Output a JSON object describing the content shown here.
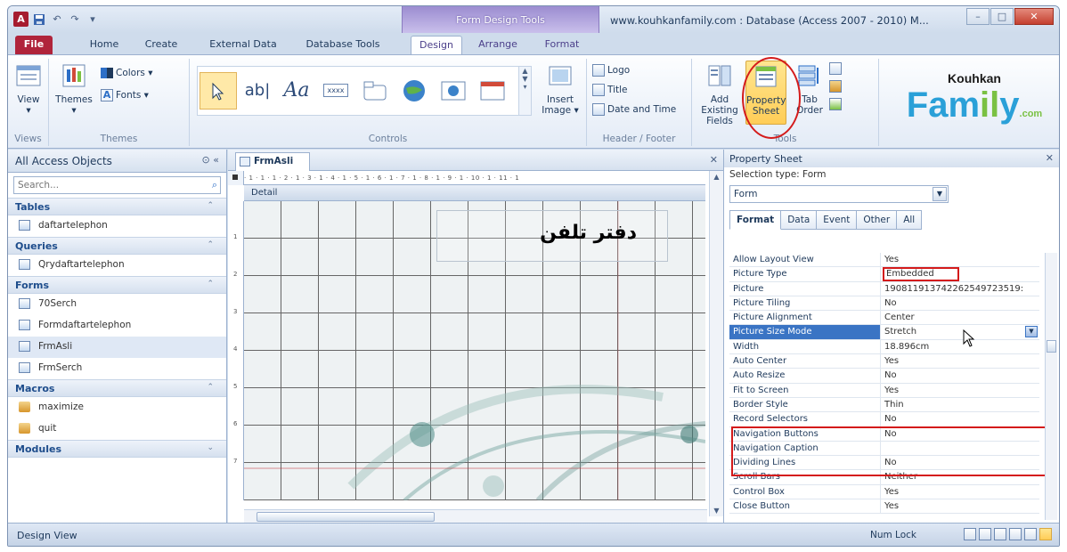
{
  "titlebar": {
    "app_logo": "A",
    "quick_access": [
      "save-icon",
      "undo-icon",
      "redo-icon",
      "customize-icon"
    ],
    "contextual_tools": "Form Design Tools",
    "window_title": "www.kouhkanfamily.com : Database (Access 2007 - 2010) M...",
    "controls": {
      "minimize": "–",
      "maximize": "□",
      "close": "✕"
    }
  },
  "tabs": [
    "File",
    "Home",
    "Create",
    "External Data",
    "Database Tools",
    "Design",
    "Arrange",
    "Format"
  ],
  "active_tab": "Design",
  "ribbon": {
    "views": {
      "view": "View",
      "label": "Views"
    },
    "themes": {
      "themes": "Themes",
      "colors": "Colors ▾",
      "fonts": "Fonts ▾",
      "label": "Themes"
    },
    "controls": {
      "insert_image": "Insert Image ▾",
      "label": "Controls",
      "gallery": [
        "select-icon",
        "textbox-icon",
        "label-icon",
        "button-icon",
        "tab-control-icon",
        "hyperlink-icon",
        "web-browser-icon",
        "navigation-icon"
      ],
      "gallery_text": {
        "textbox": "ab|",
        "label": "Aa",
        "button": "xxxx"
      }
    },
    "header_footer": {
      "logo": "Logo",
      "title": "Title",
      "date_time": "Date and Time",
      "label": "Header / Footer"
    },
    "tools": {
      "add_fields": "Add Existing Fields",
      "property_sheet": "Property Sheet",
      "tab_order": "Tab Order",
      "label": "Tools"
    },
    "brand": {
      "top": "Kouhkan",
      "main_a": "Fam",
      "main_b": "il",
      "main_c": "y",
      "domain": ".com"
    }
  },
  "nav": {
    "title": "All Access Objects",
    "search_placeholder": "Search...",
    "categories": [
      {
        "name": "Tables",
        "items": [
          "daftartelephon"
        ]
      },
      {
        "name": "Queries",
        "items": [
          "Qrydaftartelephon"
        ]
      },
      {
        "name": "Forms",
        "items": [
          "70Serch",
          "Formdaftartelephon",
          "FrmAsli",
          "FrmSerch"
        ]
      },
      {
        "name": "Macros",
        "items": [
          "maximize",
          "quit"
        ]
      },
      {
        "name": "Modules",
        "items": []
      }
    ],
    "selected_item": "FrmAsli"
  },
  "document": {
    "tab": "FrmAsli",
    "ruler": "· 1 · 1 · 1 · 2 · 1 · 3 · 1 · 4 · 1 · 5 · 1 · 6 · 1 · 7 · 1 · 8 · 1 · 9 · 1 · 10 · 1 · 11 · 1",
    "vruler": [
      "1",
      "2",
      "3",
      "4",
      "5",
      "6",
      "7"
    ],
    "section": "Detail",
    "label_text": "دفتر تلفن"
  },
  "property_sheet": {
    "title": "Property Sheet",
    "selection_type": "Selection type:  Form",
    "selected_object": "Form",
    "tabs": [
      "Format",
      "Data",
      "Event",
      "Other",
      "All"
    ],
    "active_tab": "Format",
    "rows": [
      {
        "k": "Allow Layout View",
        "v": "Yes"
      },
      {
        "k": "Picture Type",
        "v": "Embedded"
      },
      {
        "k": "Picture",
        "v": "190811913742262549723519:"
      },
      {
        "k": "Picture Tiling",
        "v": "No"
      },
      {
        "k": "Picture Alignment",
        "v": "Center"
      },
      {
        "k": "Picture Size Mode",
        "v": "Stretch"
      },
      {
        "k": "Width",
        "v": "18.896cm"
      },
      {
        "k": "Auto Center",
        "v": "Yes"
      },
      {
        "k": "Auto Resize",
        "v": "No"
      },
      {
        "k": "Fit to Screen",
        "v": "Yes"
      },
      {
        "k": "Border Style",
        "v": "Thin"
      },
      {
        "k": "Record Selectors",
        "v": "No"
      },
      {
        "k": "Navigation Buttons",
        "v": "No"
      },
      {
        "k": "Navigation Caption",
        "v": ""
      },
      {
        "k": "Dividing Lines",
        "v": "No"
      },
      {
        "k": "Scroll Bars",
        "v": "Neither"
      },
      {
        "k": "Control Box",
        "v": "Yes"
      },
      {
        "k": "Close Button",
        "v": "Yes"
      }
    ]
  },
  "status": {
    "left": "Design View",
    "num_lock": "Num Lock"
  },
  "colors": {
    "file_tab": "#b0243b",
    "highlight": "#d41b1b",
    "selection": "#3a74c4"
  }
}
